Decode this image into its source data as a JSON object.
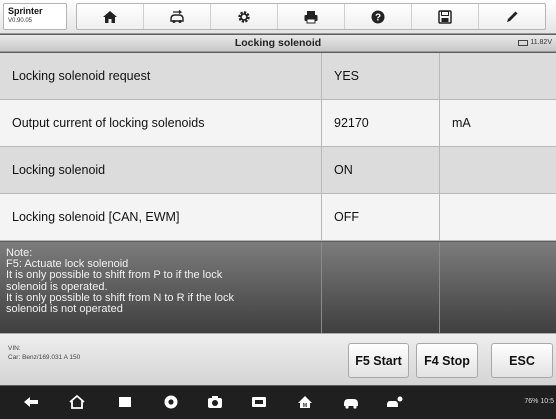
{
  "app": {
    "name": "Sprinter",
    "version": "V0.90.05"
  },
  "toolbar": {
    "buttons": [
      {
        "icon": "home-icon"
      },
      {
        "icon": "vehicle-swap-icon"
      },
      {
        "icon": "gear-icon"
      },
      {
        "icon": "printer-icon"
      },
      {
        "icon": "help-icon"
      },
      {
        "icon": "save-icon"
      },
      {
        "icon": "pen-icon"
      }
    ]
  },
  "titlebar": {
    "title": "Locking solenoid",
    "voltage": "11.82V"
  },
  "rows": [
    {
      "name": "Locking solenoid request",
      "value": "YES",
      "unit": ""
    },
    {
      "name": "Output current of locking solenoids",
      "value": "92170",
      "unit": "mA"
    },
    {
      "name": "Locking solenoid",
      "value": "ON",
      "unit": ""
    },
    {
      "name": "Locking solenoid [CAN, EWM]",
      "value": "OFF",
      "unit": ""
    }
  ],
  "note": {
    "lines": [
      "Note:",
      "F5: Actuate lock solenoid",
      "It is only possible to shift from P to if the lock",
      "solenoid is operated.",
      "It is only possible to shift from N to R if the lock",
      "solenoid is not operated"
    ]
  },
  "vehicle_info": {
    "vin_label": "VIN:",
    "car": "Car: Benz/169.031 A 150"
  },
  "actions": {
    "f5": "F5 Start",
    "f4": "F4 Stop",
    "esc": "ESC"
  },
  "status": {
    "battery_pct": "76%",
    "time": "10:5"
  },
  "colors": {
    "note_bg": "#5a5a5a",
    "row_odd": "#dcdcdc",
    "row_even": "#f4f4f4"
  }
}
